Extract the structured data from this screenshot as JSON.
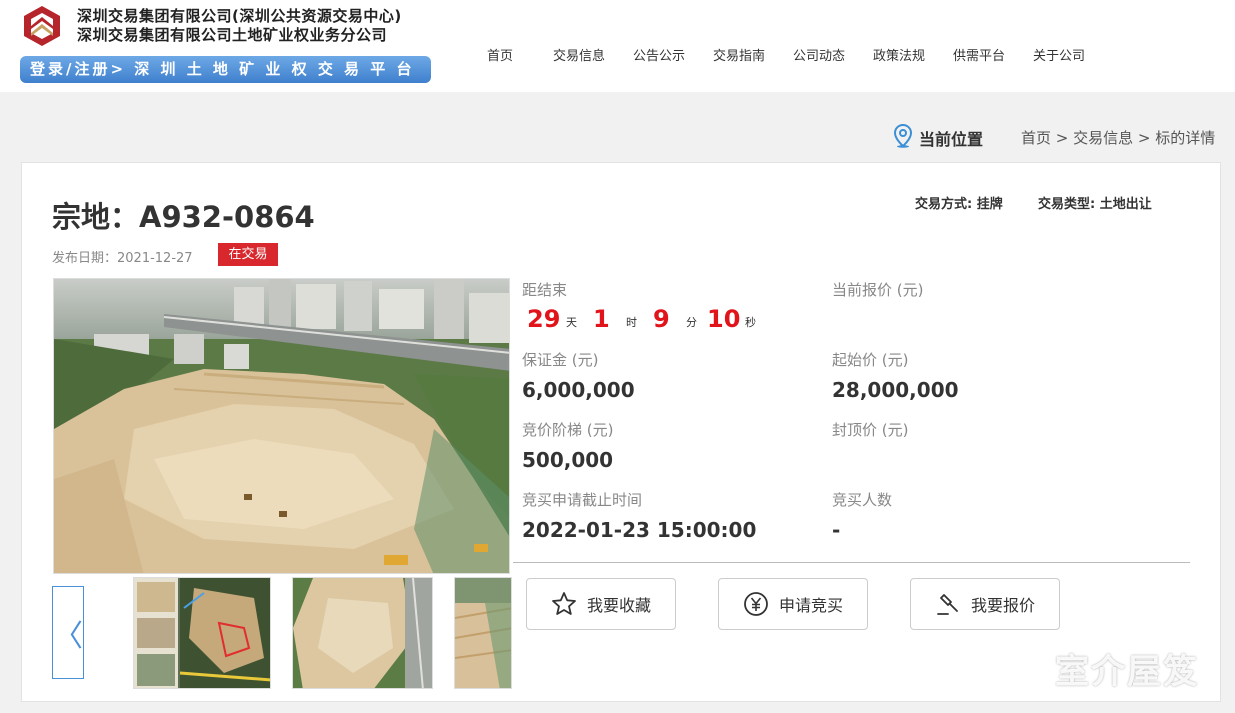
{
  "header": {
    "org_line1": "深圳交易集团有限公司(深圳公共资源交易中心)",
    "org_line2": "深圳交易集团有限公司土地矿业权业务分公司",
    "login_banner": "登录/注册> 深 圳 土 地 矿 业 权 交 易 平 台",
    "logo_icon": "hexagon-logo-icon",
    "brand_colors": {
      "logo_red": "#b5252b",
      "logo_gold": "#c9a063",
      "banner_blue": "#4a86d4"
    }
  },
  "nav": {
    "items": [
      "首页",
      "交易信息",
      "公告公示",
      "交易指南",
      "公司动态",
      "政策法规",
      "供需平台",
      "关于公司"
    ]
  },
  "breadcrumb": {
    "label": "当前位置",
    "icon": "location-pin-icon",
    "path": [
      "首页",
      "交易信息",
      "标的详情"
    ],
    "separator": " > "
  },
  "detail": {
    "title": "宗地：A932-0864",
    "trade_mode": "交易方式: 挂牌",
    "trade_type": "交易类型: 土地出让",
    "publish_date": "发布日期：2021-12-27",
    "status": "在交易",
    "status_color": "#d9282d",
    "countdown": {
      "label": "距结束",
      "days": "29",
      "days_unit": "天",
      "hours": "1",
      "hours_unit": "时",
      "minutes": "9",
      "minutes_unit": "分",
      "seconds": "10",
      "seconds_unit": "秒",
      "color": "#e0141a"
    },
    "current_price_label": "当前报价 (元)",
    "deposit_label": "保证金 (元)",
    "deposit_value": "6,000,000",
    "start_price_label": "起始价 (元)",
    "start_price_value": "28,000,000",
    "increment_label": "竞价阶梯 (元)",
    "increment_value": "500,000",
    "cap_price_label": "封顶价 (元)",
    "deadline_label": "竞买申请截止时间",
    "deadline_value": "2022-01-23 15:00:00",
    "bidders_label": "竞买人数",
    "bidders_value": "-"
  },
  "actions": {
    "favorite": {
      "label": "我要收藏",
      "icon": "star-icon"
    },
    "apply": {
      "label": "申请竞买",
      "icon": "yuan-circle-icon"
    },
    "bid": {
      "label": "我要报价",
      "icon": "gavel-icon"
    }
  },
  "gallery": {
    "prev_label": "〈",
    "prev_icon": "chevron-left-icon"
  },
  "watermark": "室介屋笈"
}
